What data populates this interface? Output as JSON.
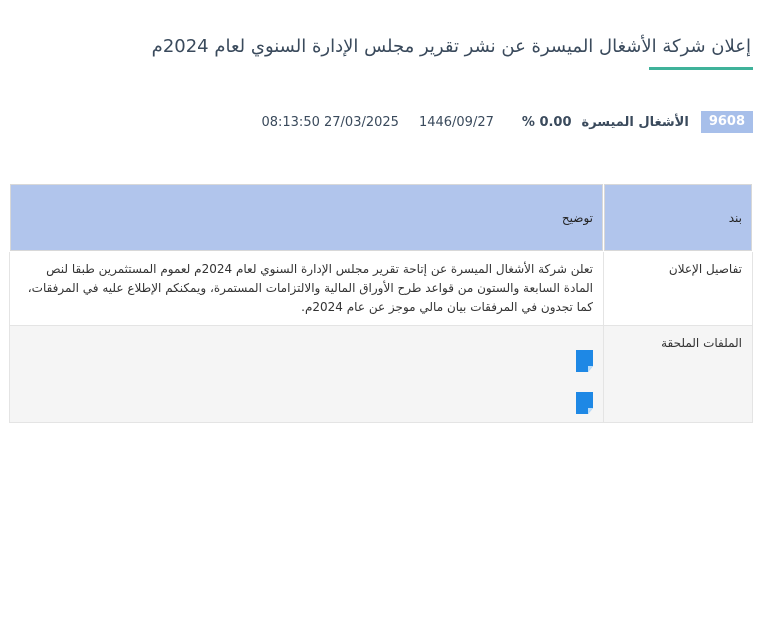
{
  "announcement": {
    "title": "إعلان شركة الأشغال الميسرة عن نشر تقرير مجلس الإدارة السنوي لعام 2024م"
  },
  "stock": {
    "symbol": "9608",
    "company": "الأشغال الميسرة",
    "change": "0.00 %",
    "date_hijri": "1446/09/27",
    "datetime": "27/03/2025 08:13:50"
  },
  "table": {
    "headers": {
      "item": "بند",
      "description": "توضيح"
    },
    "rows": [
      {
        "item": "تفاصيل الإعلان",
        "description": "تعلن شركة الأشغال الميسرة عن إتاحة تقرير مجلس الإدارة السنوي لعام 2024م لعموم المستثمرين طبقا لنص المادة السابعة والستون من قواعد طرح الأوراق المالية والالتزامات المستمرة، ويمكنكم الإطلاع عليه في المرفقات، كما تجدون في المرفقات بيان مالي موجز عن عام 2024م."
      },
      {
        "item": "الملفات الملحقة"
      }
    ],
    "attachments": [
      {
        "icon": "document-icon"
      },
      {
        "icon": "document-icon"
      }
    ]
  },
  "colors": {
    "accent_underline": "#3fb29a",
    "header_background": "#b1c5ec",
    "badge_background": "#a7bfea",
    "file_icon": "#1e88e5"
  }
}
